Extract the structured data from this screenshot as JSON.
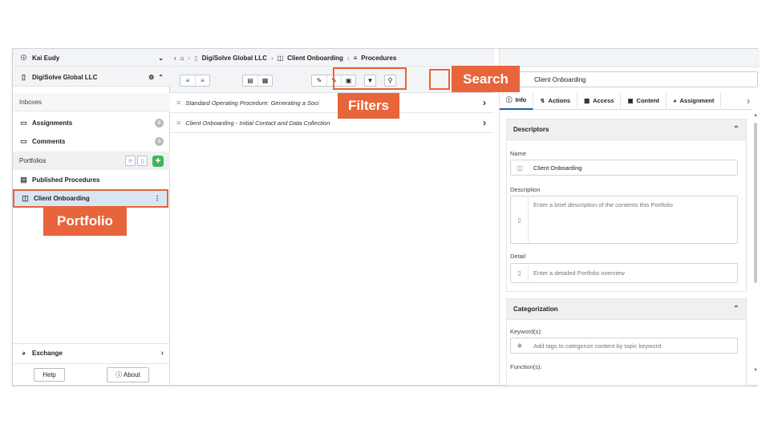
{
  "user": {
    "name": "Kai Eudy"
  },
  "org": {
    "name": "DigiSolve Global LLC"
  },
  "sidebar": {
    "inboxes_label": "Inboxes",
    "assignments_label": "Assignments",
    "assignments_count": "0",
    "comments_label": "Comments",
    "comments_count": "0",
    "portfolios_label": "Portfolios",
    "published_label": "Published Procedures",
    "client_label": "Client Onboarding",
    "exchange_label": "Exchange",
    "help_label": "Help",
    "about_label": "About"
  },
  "breadcrumb": {
    "org": "DigiSolve Global LLC",
    "portfolio": "Client Onboarding",
    "section": "Procedures"
  },
  "list": {
    "items": [
      "Standard Operating Procedure: Generating a Soci",
      "Client Onboarding - Initial Contact and Data Collection"
    ]
  },
  "search": {
    "value": "Client Onboarding"
  },
  "tabs": [
    "Info",
    "Actions",
    "Access",
    "Content",
    "Assignment"
  ],
  "descriptors": {
    "title": "Descriptors",
    "name_label": "Name",
    "name_value": "Client Onboarding",
    "description_label": "Description",
    "description_placeholder": "Enter a brief description of the contents this Portfolio",
    "detail_label": "Detail",
    "detail_placeholder": "Enter a detailed Portfolio overview"
  },
  "categorization": {
    "title": "Categorization",
    "keywords_label": "Keyword(s):",
    "keywords_placeholder": "Add tags to categorize content by topic keyword",
    "function_label": "Function(s):"
  },
  "callouts": {
    "search": "Search",
    "filters": "Filters",
    "portfolio": "Portfolio"
  },
  "colors": {
    "accent": "#e8643a",
    "brand": "#1b5fa6",
    "selected": "#d8e6f4"
  }
}
